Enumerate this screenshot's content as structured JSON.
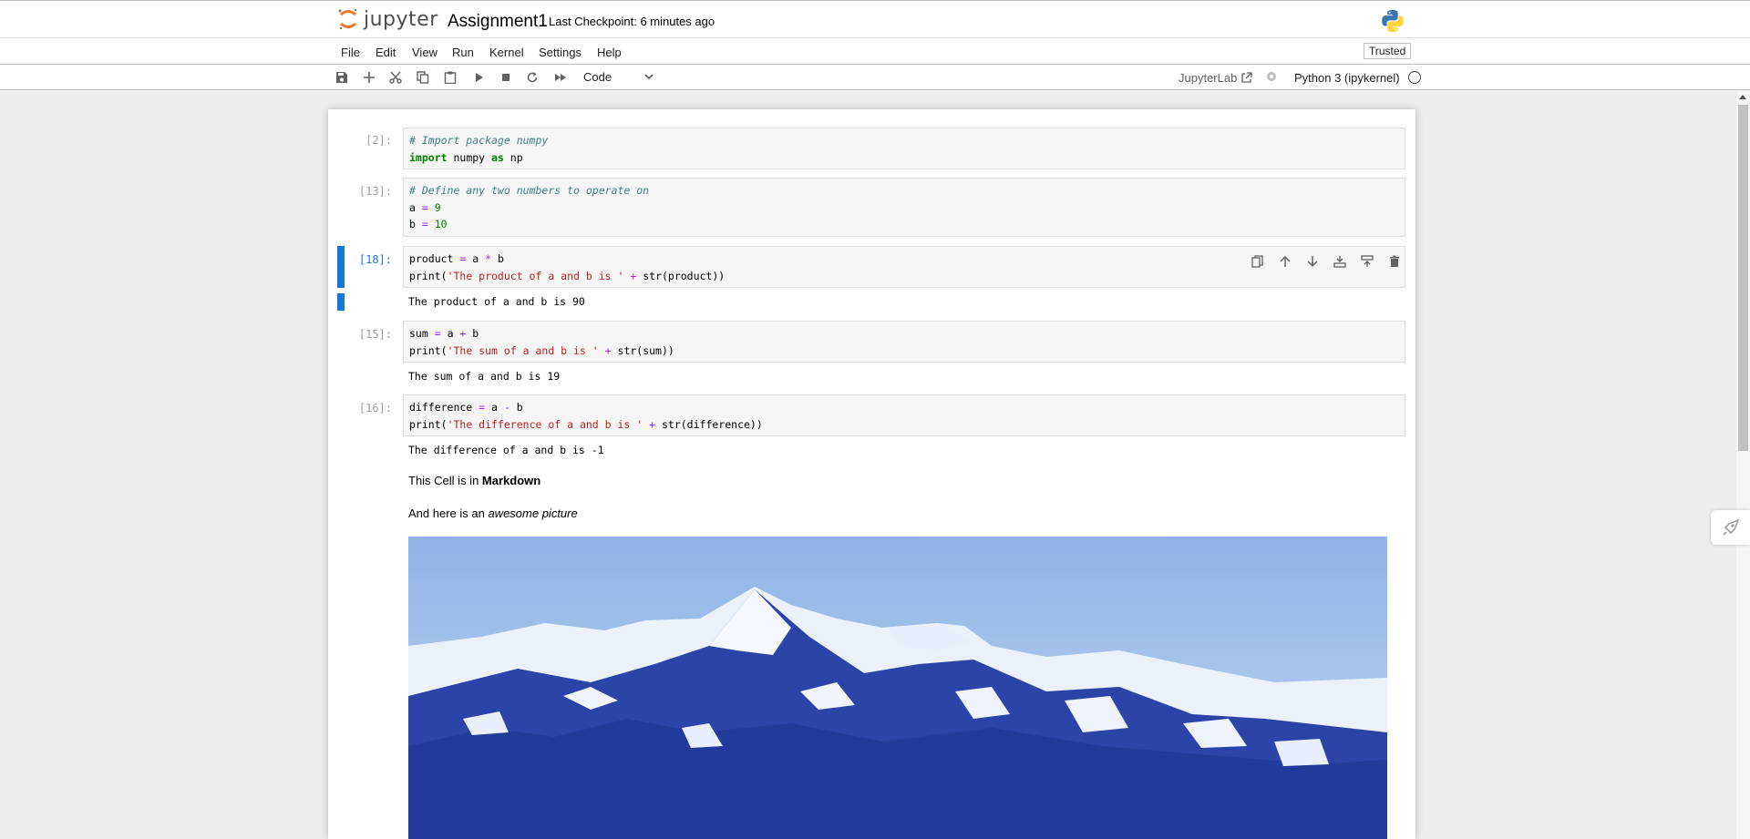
{
  "header": {
    "logo_text": "jupyter",
    "notebook_title": "Assignment1",
    "checkpoint": "Last Checkpoint: 6 minutes ago"
  },
  "menu": {
    "items": [
      "File",
      "Edit",
      "View",
      "Run",
      "Kernel",
      "Settings",
      "Help"
    ],
    "trusted": "Trusted"
  },
  "toolbar": {
    "cell_type": "Code",
    "jupyterlab_label": "JupyterLab",
    "kernel_name": "Python 3 (ipykernel)",
    "icons": [
      "save-icon",
      "add-icon",
      "cut-icon",
      "copy-icon",
      "paste-icon",
      "run-icon",
      "stop-icon",
      "restart-icon",
      "fast-forward-icon"
    ]
  },
  "cells": [
    {
      "prompt": "[2]:",
      "lines": [
        [
          {
            "t": "# Import package numpy",
            "c": "cm"
          }
        ],
        [
          {
            "t": "import",
            "c": "kw"
          },
          {
            "t": " numpy ",
            "c": "nm"
          },
          {
            "t": "as",
            "c": "kw"
          },
          {
            "t": " np",
            "c": "nm"
          }
        ]
      ]
    },
    {
      "prompt": "[13]:",
      "lines": [
        [
          {
            "t": "# Define any two numbers to operate on",
            "c": "cm"
          }
        ],
        [
          {
            "t": "a ",
            "c": "nm"
          },
          {
            "t": "=",
            "c": "op"
          },
          {
            "t": " ",
            "c": "nm"
          },
          {
            "t": "9",
            "c": "num"
          }
        ],
        [
          {
            "t": "b ",
            "c": "nm"
          },
          {
            "t": "=",
            "c": "op"
          },
          {
            "t": " ",
            "c": "nm"
          },
          {
            "t": "10",
            "c": "num"
          }
        ]
      ]
    },
    {
      "prompt": "[18]:",
      "lines": [
        [
          {
            "t": "product ",
            "c": "nm"
          },
          {
            "t": "=",
            "c": "op"
          },
          {
            "t": " a ",
            "c": "nm"
          },
          {
            "t": "*",
            "c": "op"
          },
          {
            "t": " b",
            "c": "nm"
          }
        ],
        [
          {
            "t": "print(",
            "c": "nm"
          },
          {
            "t": "'The product of a and b is '",
            "c": "str"
          },
          {
            "t": " ",
            "c": "nm"
          },
          {
            "t": "+",
            "c": "op"
          },
          {
            "t": " str(product))",
            "c": "nm"
          }
        ]
      ],
      "output": "The product of a and b is 90"
    },
    {
      "prompt": "[15]:",
      "lines": [
        [
          {
            "t": "sum ",
            "c": "nm"
          },
          {
            "t": "=",
            "c": "op"
          },
          {
            "t": " a ",
            "c": "nm"
          },
          {
            "t": "+",
            "c": "op"
          },
          {
            "t": " b",
            "c": "nm"
          }
        ],
        [
          {
            "t": "print(",
            "c": "nm"
          },
          {
            "t": "'The sum of a and b is '",
            "c": "str"
          },
          {
            "t": " ",
            "c": "nm"
          },
          {
            "t": "+",
            "c": "op"
          },
          {
            "t": " str(sum))",
            "c": "nm"
          }
        ]
      ],
      "output": "The sum of a and b is 19"
    },
    {
      "prompt": "[16]:",
      "lines": [
        [
          {
            "t": "difference ",
            "c": "nm"
          },
          {
            "t": "=",
            "c": "op"
          },
          {
            "t": " a ",
            "c": "nm"
          },
          {
            "t": "-",
            "c": "op"
          },
          {
            "t": " b",
            "c": "nm"
          }
        ],
        [
          {
            "t": "print(",
            "c": "nm"
          },
          {
            "t": "'The difference of a and b is '",
            "c": "str"
          },
          {
            "t": " ",
            "c": "nm"
          },
          {
            "t": "+",
            "c": "op"
          },
          {
            "t": " str(difference))",
            "c": "nm"
          }
        ]
      ],
      "output": "The difference of a and b is -1"
    }
  ],
  "markdown": {
    "line1_prefix": "This Cell is in ",
    "line1_bold": "Markdown",
    "line2_prefix": "And here is an ",
    "line2_italic": "awesome picture"
  },
  "cell_tool_icons": [
    "duplicate-icon",
    "move-up-icon",
    "move-down-icon",
    "insert-above-icon",
    "insert-below-icon",
    "delete-icon"
  ],
  "colors": {
    "accent": "#1976d2",
    "jupyter_orange": "#f37726"
  }
}
